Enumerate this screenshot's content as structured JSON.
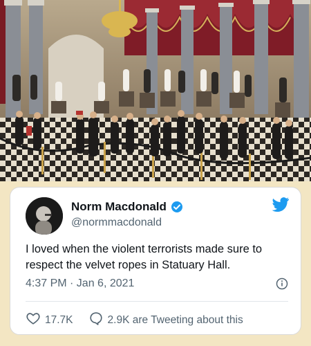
{
  "tweet": {
    "author_name": "Norm Macdonald",
    "handle": "@normmacdonald",
    "text": "I loved when the violent terrorists made sure to respect the velvet ropes in Statuary Hall.",
    "timestamp": "4:37 PM · Jan 6, 2021",
    "likes": "17.7K",
    "tweeting": "2.9K are Tweeting about this"
  },
  "icons": {
    "verified": "verified-badge-icon",
    "brand": "twitter-bird-icon",
    "info": "info-icon",
    "like": "heart-icon",
    "reply": "speech-bubble-icon"
  },
  "colors": {
    "accent": "#1d9bf0",
    "text": "#0f1419",
    "muted": "#536471",
    "background": "#f3e6c3"
  }
}
